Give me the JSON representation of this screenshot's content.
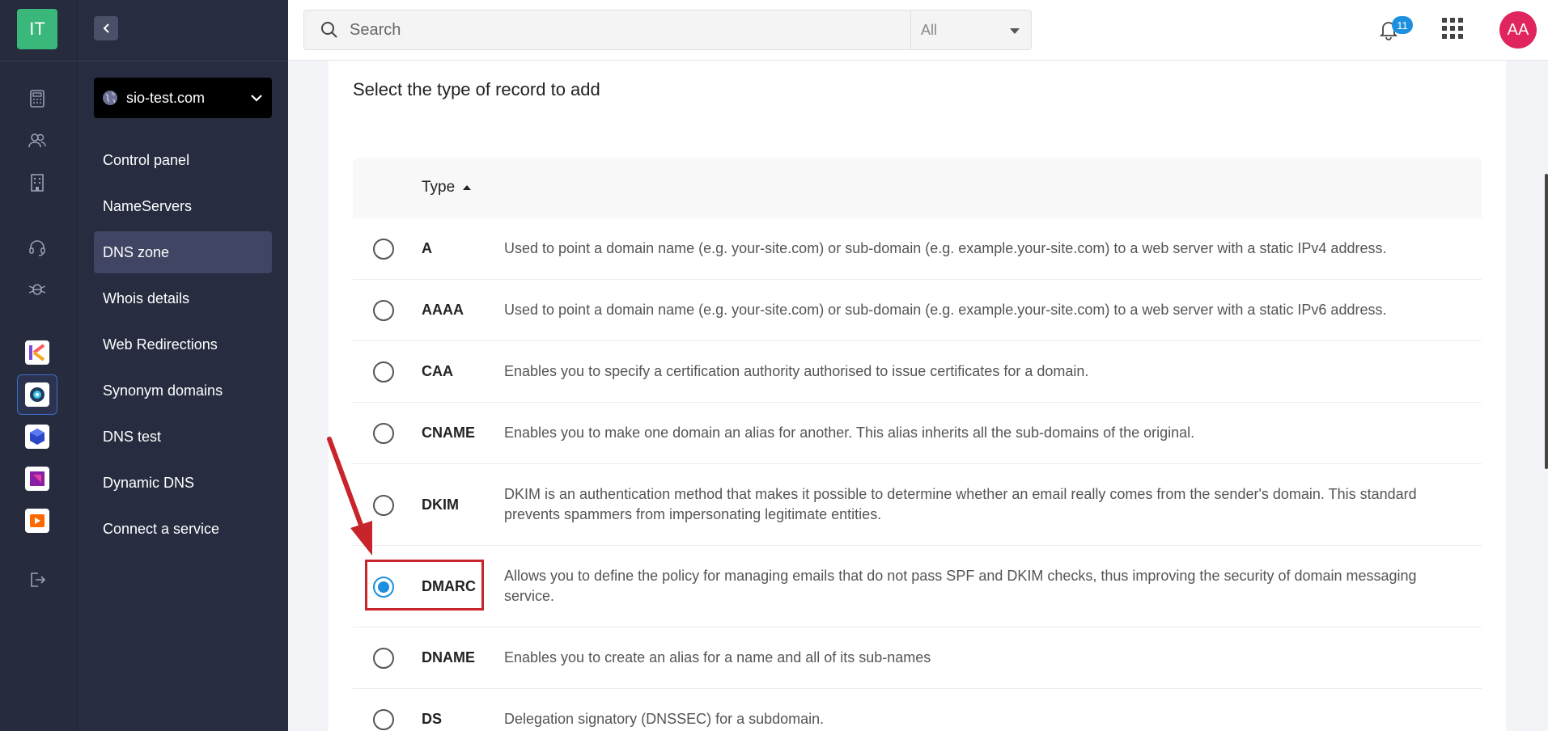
{
  "rail": {
    "logo_text": "IT",
    "icons": [
      "calculator-icon",
      "users-icon",
      "building-icon",
      "headset-icon",
      "bug-icon"
    ],
    "apps": [
      "app-k-icon",
      "app-disc-icon",
      "app-cube-icon",
      "app-square-icon",
      "app-play-icon"
    ],
    "logout_icon": "logout-icon"
  },
  "sidebar": {
    "domain": "sio-test.com",
    "items": [
      {
        "label": "Control panel",
        "active": false
      },
      {
        "label": "NameServers",
        "active": false
      },
      {
        "label": "DNS zone",
        "active": true
      },
      {
        "label": "Whois details",
        "active": false
      },
      {
        "label": "Web Redirections",
        "active": false
      },
      {
        "label": "Synonym domains",
        "active": false
      },
      {
        "label": "DNS test",
        "active": false
      },
      {
        "label": "Dynamic DNS",
        "active": false
      },
      {
        "label": "Connect a service",
        "active": false
      }
    ]
  },
  "header": {
    "search_placeholder": "Search",
    "scope": "All",
    "notifications": "11",
    "avatar": "AA"
  },
  "main": {
    "title": "Select the type of record to add",
    "column_header": "Type",
    "records": [
      {
        "type": "A",
        "description": "Used to point a domain name (e.g. your-site.com) or sub-domain (e.g. example.your-site.com) to a web server with a static IPv4 address.",
        "selected": false
      },
      {
        "type": "AAAA",
        "description": "Used to point a domain name (e.g. your-site.com) or sub-domain (e.g. example.your-site.com) to a web server with a static IPv6 address.",
        "selected": false
      },
      {
        "type": "CAA",
        "description": "Enables you to specify a certification authority authorised to issue certificates for a domain.",
        "selected": false
      },
      {
        "type": "CNAME",
        "description": "Enables you to make one domain an alias for another. This alias inherits all the sub-domains of the original.",
        "selected": false
      },
      {
        "type": "DKIM",
        "description": "DKIM is an authentication method that makes it possible to determine whether an email really comes from the sender's domain. This standard prevents spammers from impersonating legitimate entities.",
        "selected": false
      },
      {
        "type": "DMARC",
        "description": "Allows you to define the policy for managing emails that do not pass SPF and DKIM checks, thus improving the security of domain messaging service.",
        "selected": true
      },
      {
        "type": "DNAME",
        "description": "Enables you to create an alias for a name and all of its sub-names",
        "selected": false
      },
      {
        "type": "DS",
        "description": "Delegation signatory (DNSSEC) for a subdomain.",
        "selected": false
      }
    ]
  },
  "colors": {
    "rail_bg": "#262b3e",
    "accent": "#1d8fe0",
    "logo": "#3ab77a",
    "annotation": "#c8242b",
    "avatar": "#e0245e"
  }
}
